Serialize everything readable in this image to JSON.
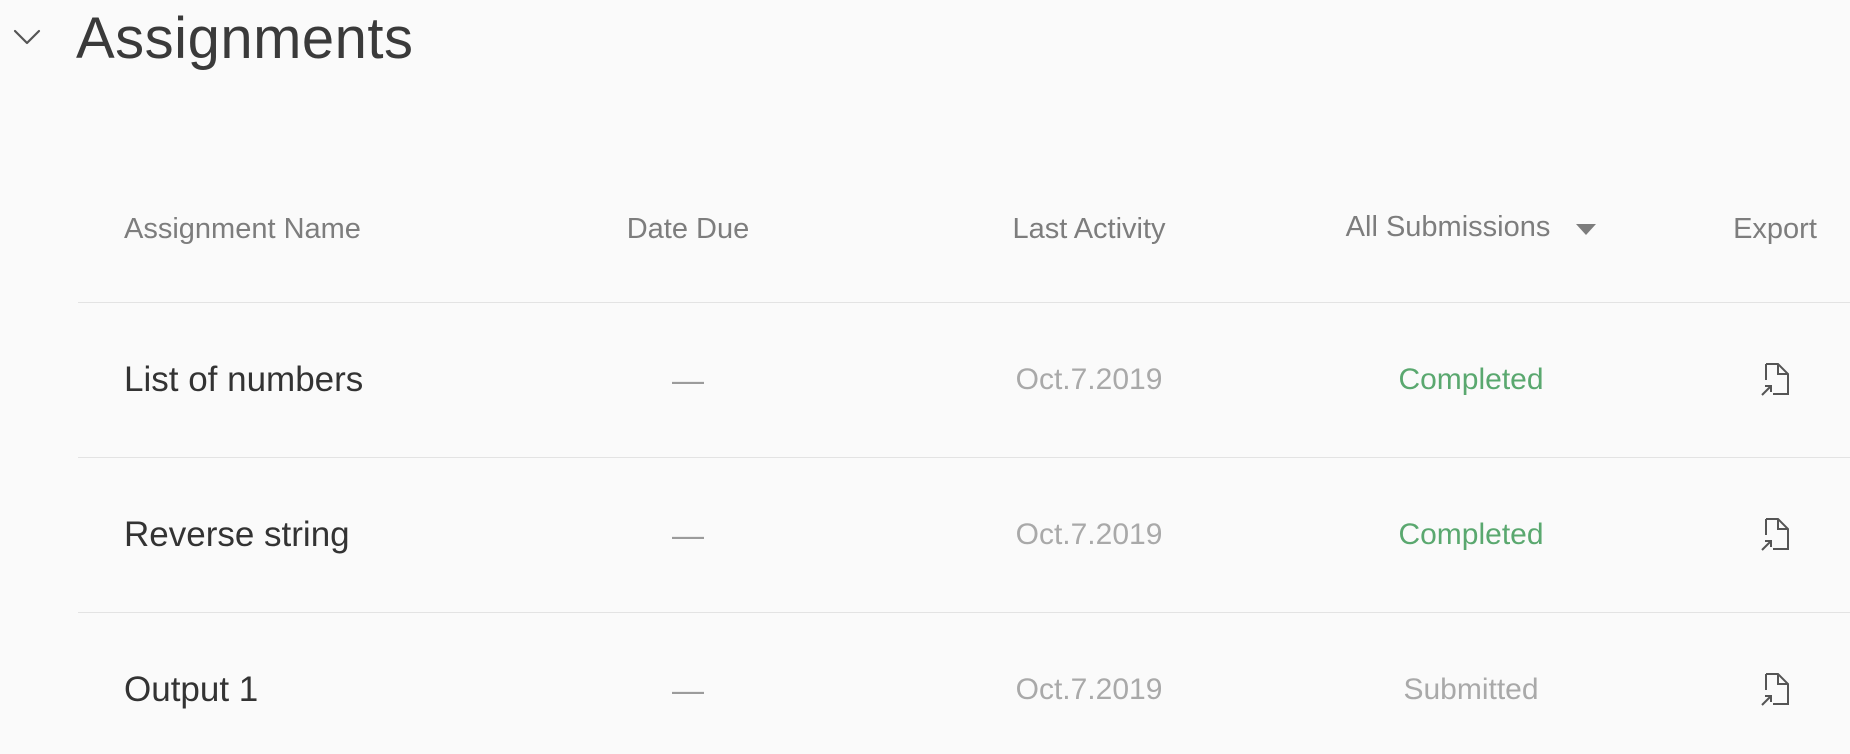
{
  "section": {
    "title": "Assignments",
    "toggle_icon": "chevron-down-icon"
  },
  "table": {
    "headers": {
      "name": "Assignment Name",
      "date_due": "Date Due",
      "last_activity": "Last Activity",
      "submissions_filter": "All Submissions",
      "export": "Export"
    },
    "rows": [
      {
        "name": "List of numbers",
        "date_due": "—",
        "last_activity": "Oct.7.2019",
        "status": "Completed",
        "status_color": "#5aa86f",
        "export_icon": "file-export-icon"
      },
      {
        "name": "Reverse string",
        "date_due": "—",
        "last_activity": "Oct.7.2019",
        "status": "Completed",
        "status_color": "#5aa86f",
        "export_icon": "file-export-icon"
      },
      {
        "name": "Output 1",
        "date_due": "—",
        "last_activity": "Oct.7.2019",
        "status": "Submitted",
        "status_color": "#a9a9a9",
        "export_icon": "file-export-icon"
      }
    ]
  }
}
